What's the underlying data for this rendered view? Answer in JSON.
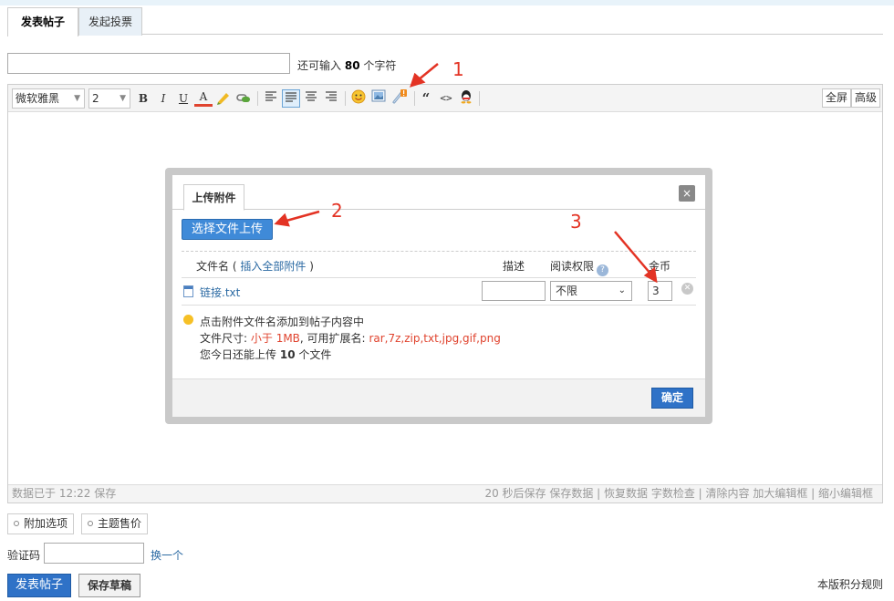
{
  "tabs": [
    {
      "label": "发表帖子",
      "active": true
    },
    {
      "label": "发起投票",
      "active": false
    }
  ],
  "title_field": {
    "value": "",
    "hint_prefix": "还可输入",
    "hint_count": "80",
    "hint_suffix": "个字符"
  },
  "toolbar": {
    "font_family": "微软雅黑",
    "font_size": "2",
    "bold": "B",
    "italic": "I",
    "underline": "U",
    "font_color": "A",
    "quote": "“",
    "code": "<>",
    "fullscreen": "全屏",
    "advanced": "高级"
  },
  "status": {
    "saved": "数据已于 12:22 保存",
    "actions": "20 秒后保存 保存数据 | 恢复数据    字数检查 | 清除内容    加大编辑框 | 缩小编辑框"
  },
  "dialog": {
    "tab": "上传附件",
    "close": "×",
    "upload_button": "选择文件上传",
    "headers": {
      "filename": "文件名",
      "insert_all_open": "(",
      "insert_all": "插入全部附件",
      "insert_all_close": ")",
      "desc": "描述",
      "permission": "阅读权限",
      "gold": "金币",
      "help": "?"
    },
    "file": {
      "name": "链接.txt",
      "desc": "",
      "permission": "不限",
      "gold": "3"
    },
    "tips": {
      "line1": "点击附件文件名添加到帖子内容中",
      "size_prefix": "文件尺寸:",
      "size_value": "小于 1MB",
      "ext_prefix": ", 可用扩展名:",
      "ext_value": "rar,7z,zip,txt,jpg,gif,png",
      "remaining_prefix": "您今日还能上传",
      "remaining_count": "10",
      "remaining_suffix": "个文件"
    },
    "ok": "确定"
  },
  "annotations": [
    "1",
    "2",
    "3"
  ],
  "extra_options": [
    "附加选项",
    "主题售价"
  ],
  "captcha": {
    "label": "验证码",
    "value": "",
    "change": "换一个"
  },
  "buttons": {
    "submit": "发表帖子",
    "draft": "保存草稿"
  },
  "rules_link": "本版积分规则",
  "colors": {
    "accent_blue": "#2f72c7",
    "annotation_red": "#e33324",
    "link_blue": "#2b6aa3"
  }
}
